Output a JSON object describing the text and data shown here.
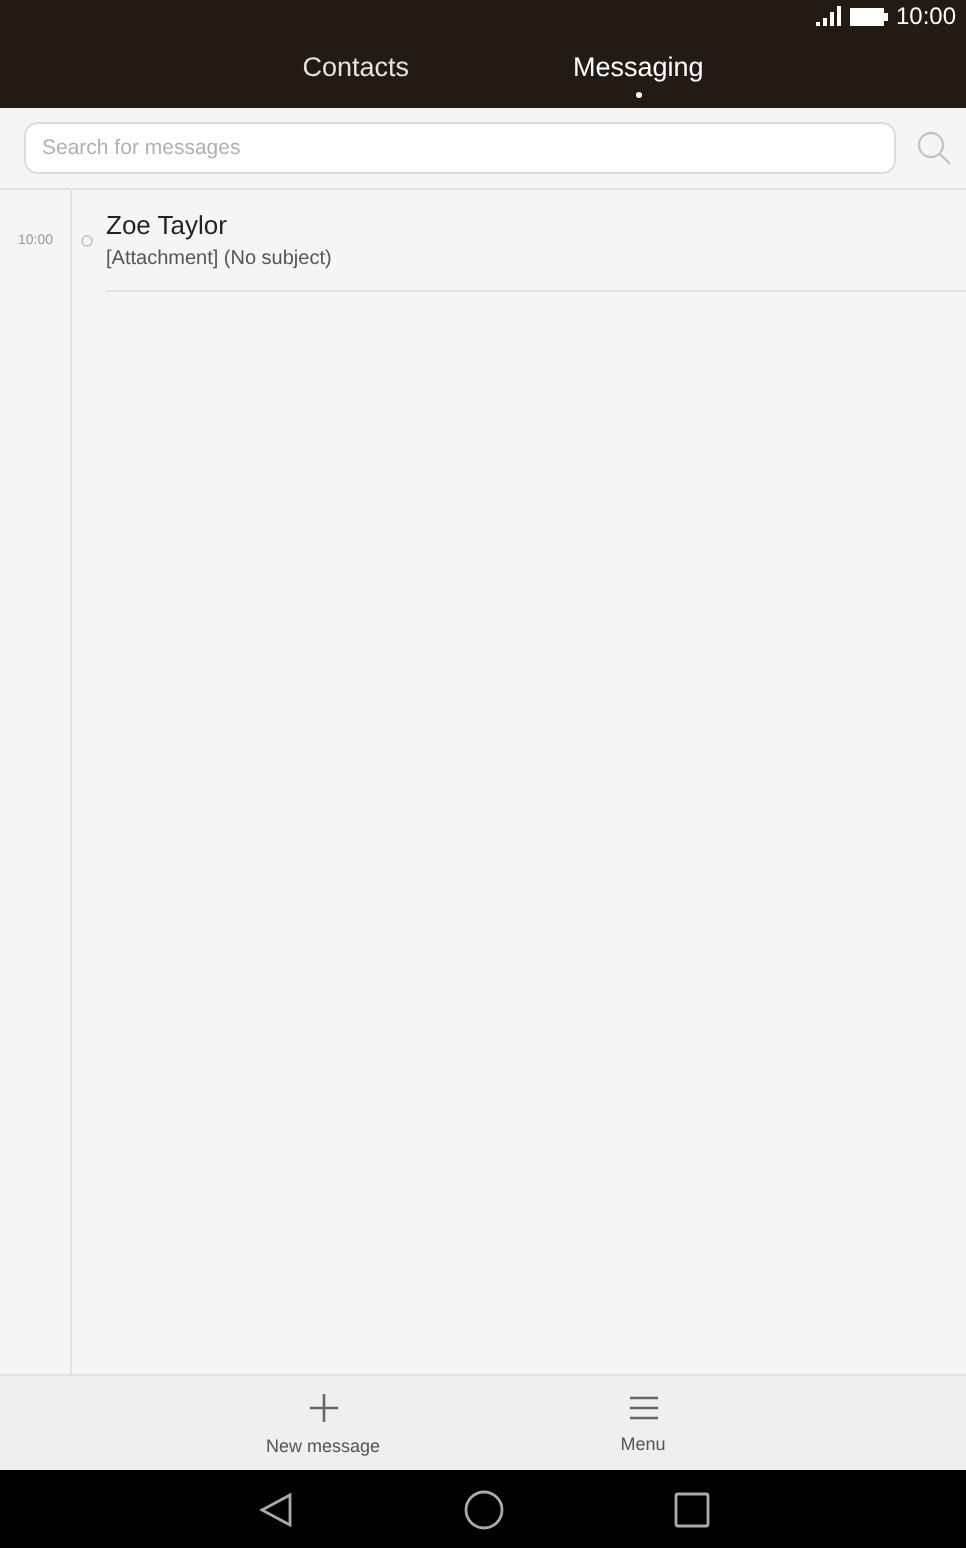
{
  "status_bar": {
    "time": "10:00"
  },
  "tabs": [
    {
      "label": "Contacts",
      "selected": false
    },
    {
      "label": "Messaging",
      "selected": true
    }
  ],
  "search": {
    "placeholder": "Search for messages"
  },
  "conversations": [
    {
      "time": "10:00",
      "name": "Zoe Taylor",
      "preview": "[Attachment] (No subject)"
    }
  ],
  "actions": [
    {
      "kind": "add",
      "label": "New message"
    },
    {
      "kind": "menu",
      "label": "Menu"
    }
  ]
}
